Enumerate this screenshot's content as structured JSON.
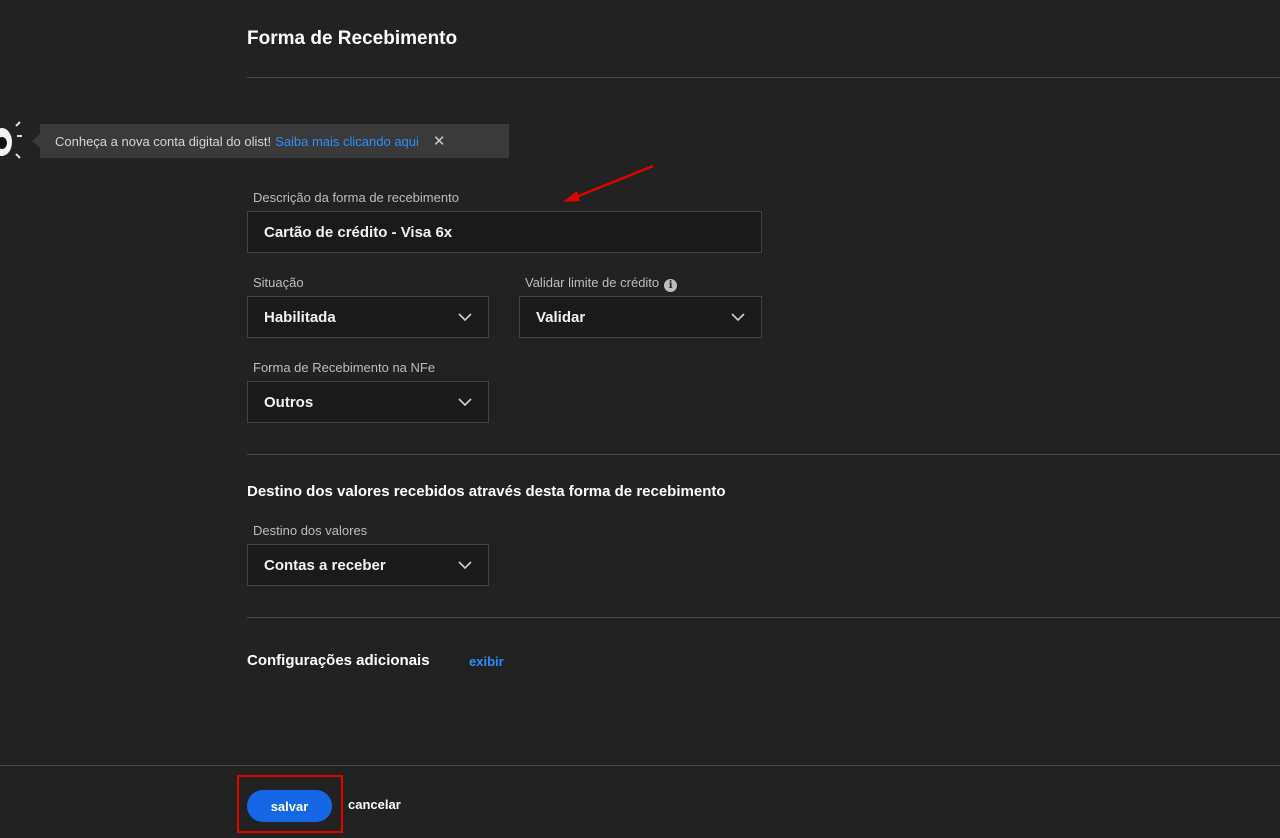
{
  "page": {
    "title": "Forma de Recebimento"
  },
  "banner": {
    "text": "Conheça a nova conta digital do olist!",
    "link": "Saiba mais clicando aqui",
    "close": "✕"
  },
  "form": {
    "descricao": {
      "label": "Descrição da forma de recebimento",
      "value": "Cartão de crédito - Visa 6x"
    },
    "situacao": {
      "label": "Situação",
      "value": "Habilitada"
    },
    "validar": {
      "label": "Validar limite de crédito",
      "value": "Validar",
      "info": "i"
    },
    "nfe": {
      "label": "Forma de Recebimento na NFe",
      "value": "Outros"
    }
  },
  "destino": {
    "title": "Destino dos valores recebidos através desta forma de recebimento",
    "label": "Destino dos valores",
    "value": "Contas a receber"
  },
  "config": {
    "title": "Configurações adicionais",
    "toggle": "exibir"
  },
  "footer": {
    "save": "salvar",
    "cancel": "cancelar"
  },
  "colors": {
    "accent": "#1667e6",
    "link": "#2e8fff",
    "annotation": "#e00000"
  }
}
